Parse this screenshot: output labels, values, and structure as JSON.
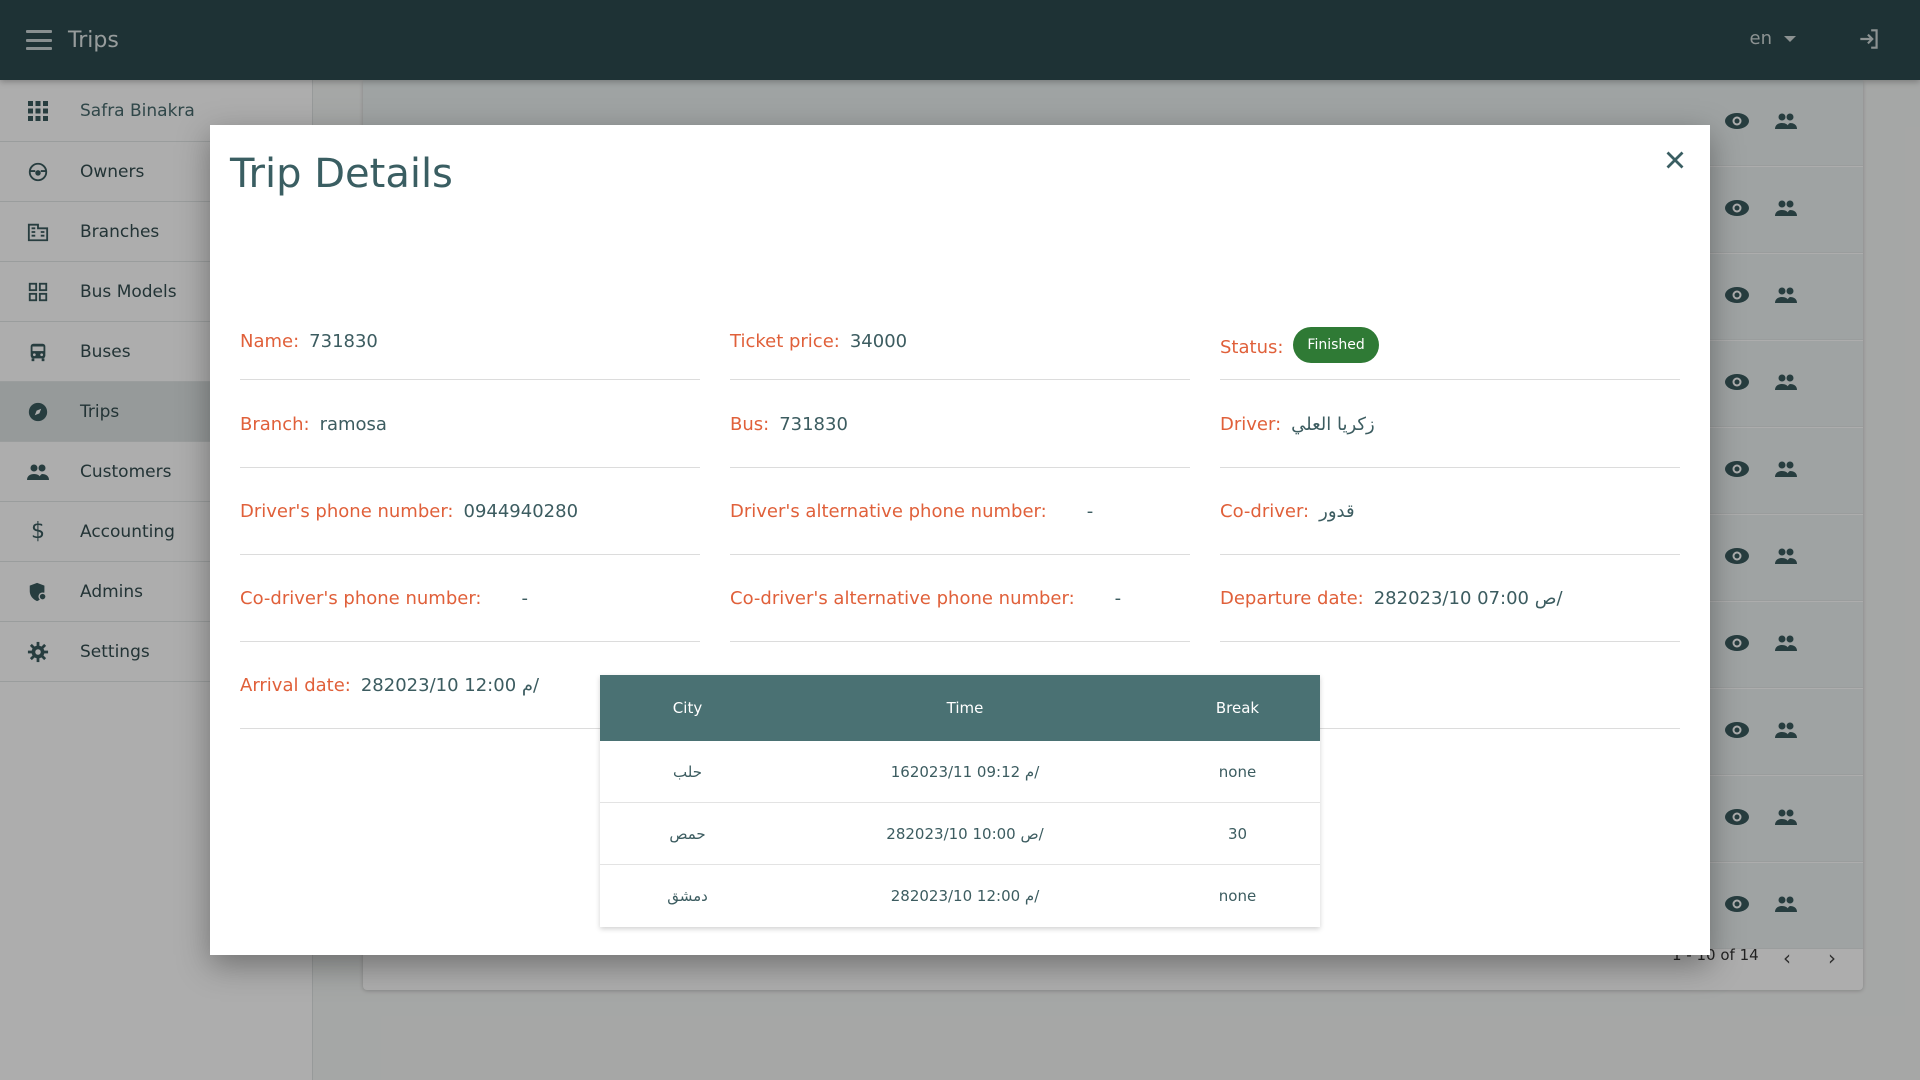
{
  "header": {
    "title": "Trips",
    "language": "en"
  },
  "sidebar": {
    "user_name": "Safra Binakra",
    "items": [
      {
        "label": "Owners",
        "icon": "steering-icon"
      },
      {
        "label": "Branches",
        "icon": "building-icon"
      },
      {
        "label": "Bus Models",
        "icon": "grid-icon"
      },
      {
        "label": "Buses",
        "icon": "bus-icon"
      },
      {
        "label": "Trips",
        "icon": "compass-icon",
        "active": true
      },
      {
        "label": "Customers",
        "icon": "people-icon"
      },
      {
        "label": "Accounting",
        "icon": "dollar-icon"
      },
      {
        "label": "Admins",
        "icon": "shield-user-icon"
      },
      {
        "label": "Settings",
        "icon": "gear-icon"
      }
    ]
  },
  "background_table": {
    "pagination": "1 - 10 of 14"
  },
  "modal": {
    "title": "Trip Details",
    "fields": {
      "name": {
        "label": "Name:",
        "value": "731830"
      },
      "ticket_price": {
        "label": "Ticket price:",
        "value": "34000"
      },
      "status": {
        "label": "Status:",
        "value": "Finished",
        "color": "#2f7a35"
      },
      "branch": {
        "label": "Branch:",
        "value": "ramosa"
      },
      "bus": {
        "label": "Bus:",
        "value": "731830"
      },
      "driver": {
        "label": "Driver:",
        "value": "زكريا العلي"
      },
      "driver_phone": {
        "label": "Driver's phone number:",
        "value": "0944940280"
      },
      "driver_alt_phone": {
        "label": "Driver's alternative phone number:",
        "value": "-"
      },
      "co_driver": {
        "label": "Co-driver:",
        "value": "قدور"
      },
      "co_driver_phone": {
        "label": "Co-driver's phone number:",
        "value": "-"
      },
      "co_driver_alt_phone": {
        "label": "Co-driver's alternative phone number:",
        "value": "-"
      },
      "departure_date": {
        "label": "Departure date:",
        "value": "28ص 07:00 2023/10/"
      },
      "arrival_date": {
        "label": "Arrival date:",
        "value": "28م 12:00 2023/10/"
      }
    },
    "stops": {
      "headers": [
        "City",
        "Time",
        "Break"
      ],
      "rows": [
        {
          "city": "حلب",
          "time": "16م 09:12 2023/11/",
          "break": "none"
        },
        {
          "city": "حمص",
          "time": "28ص 10:00 2023/10/",
          "break": "30"
        },
        {
          "city": "دمشق",
          "time": "28م 12:00 2023/10/",
          "break": "none"
        }
      ]
    }
  }
}
